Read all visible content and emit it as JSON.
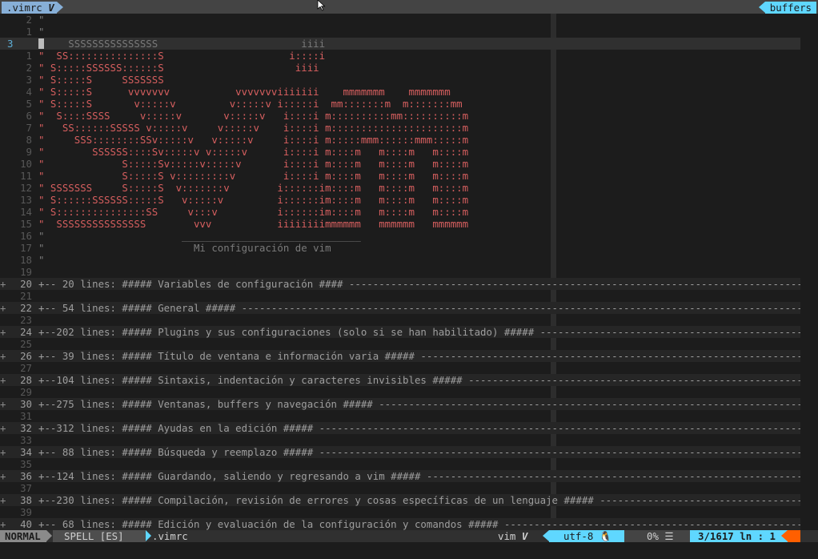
{
  "tabline": {
    "left_tab": ".vimrc",
    "left_icon": "V",
    "right_tab": "buffers"
  },
  "editor": {
    "lines": [
      {
        "n": "2",
        "t": "\"",
        "kind": "comment"
      },
      {
        "n": "1",
        "t": "\"",
        "kind": "comment"
      },
      {
        "n": "3",
        "t": "\"    SSSSSSSSSSSSSSS                        iiii",
        "kind": "cur"
      },
      {
        "n": "1",
        "t": "\"  SS:::::::::::::::S                     i::::i",
        "kind": "art"
      },
      {
        "n": "2",
        "t": "\" S:::::SSSSSS::::::S                      iiii",
        "kind": "art"
      },
      {
        "n": "3",
        "t": "\" S:::::S     SSSSSSS",
        "kind": "art"
      },
      {
        "n": "4",
        "t": "\" S:::::S      vvvvvvv           vvvvvvviiiiiii    mmmmmmm    mmmmmmm",
        "kind": "art"
      },
      {
        "n": "5",
        "t": "\" S:::::S       v:::::v         v:::::v i:::::i  mm:::::::m  m:::::::mm",
        "kind": "art"
      },
      {
        "n": "6",
        "t": "\"  S::::SSSS     v:::::v       v:::::v   i::::i m::::::::::mm::::::::::m",
        "kind": "art"
      },
      {
        "n": "7",
        "t": "\"   SS::::::SSSSS v:::::v     v:::::v    i::::i m::::::::::::::::::::::m",
        "kind": "art"
      },
      {
        "n": "8",
        "t": "\"     SSS::::::::SSv:::::v   v:::::v     i::::i m:::::mmm::::::mmm:::::m",
        "kind": "art"
      },
      {
        "n": "9",
        "t": "\"        SSSSSS::::Sv:::::v v:::::v      i::::i m::::m   m::::m   m::::m",
        "kind": "art"
      },
      {
        "n": "10",
        "t": "\"             S:::::Sv:::::v:::::v       i::::i m::::m   m::::m   m::::m",
        "kind": "art"
      },
      {
        "n": "11",
        "t": "\"             S:::::S v:::::::::v        i::::i m::::m   m::::m   m::::m",
        "kind": "art"
      },
      {
        "n": "12",
        "t": "\" SSSSSSS     S:::::S  v:::::::v        i::::::im::::m   m::::m   m::::m",
        "kind": "art"
      },
      {
        "n": "13",
        "t": "\" S::::::SSSSSS:::::S   v:::::v         i::::::im::::m   m::::m   m::::m",
        "kind": "art"
      },
      {
        "n": "14",
        "t": "\" S:::::::::::::::SS     v:::v          i::::::im::::m   m::::m   m::::m",
        "kind": "art"
      },
      {
        "n": "15",
        "t": "\"  SSSSSSSSSSSSSSS        vvv           iiiiiiiimmmmmm   mmmmmm   mmmmmm",
        "kind": "art"
      },
      {
        "n": "16",
        "t": "\"                       ______________________________",
        "kind": "comment"
      },
      {
        "n": "17",
        "t": "\"                         Mi configuración de vim",
        "kind": "comment"
      },
      {
        "n": "18",
        "t": "\"",
        "kind": "comment"
      },
      {
        "n": "19",
        "t": "",
        "kind": "blank"
      },
      {
        "n": "20",
        "t": "+-- 20 lines: ##### Variables de configuración #### ---------------------------------------------------------------------------------------------",
        "kind": "fold"
      },
      {
        "n": "21",
        "t": "",
        "kind": "blank"
      },
      {
        "n": "22",
        "t": "+-- 54 lines: ##### General ##### ----------------------------------------------------------------------------------------------------------------",
        "kind": "fold"
      },
      {
        "n": "23",
        "t": "",
        "kind": "blank"
      },
      {
        "n": "24",
        "t": "+--202 lines: ##### Plugins y sus configuraciones (solo si se han habilitado) ##### ---------------------------------------------------------------",
        "kind": "fold"
      },
      {
        "n": "25",
        "t": "",
        "kind": "blank"
      },
      {
        "n": "26",
        "t": "+-- 39 lines: ##### Título de ventana e información varia ##### ----------------------------------------------------------------------------------",
        "kind": "fold"
      },
      {
        "n": "27",
        "t": "",
        "kind": "blank"
      },
      {
        "n": "28",
        "t": "+--104 lines: ##### Sintaxis, indentación y caracteres invisibles ##### --------------------------------------------------------------------------",
        "kind": "fold"
      },
      {
        "n": "29",
        "t": "",
        "kind": "blank"
      },
      {
        "n": "30",
        "t": "+--275 lines: ##### Ventanas, buffers y navegación ##### -----------------------------------------------------------------------------------------",
        "kind": "fold"
      },
      {
        "n": "31",
        "t": "",
        "kind": "blank"
      },
      {
        "n": "32",
        "t": "+--312 lines: ##### Ayudas en la edición ##### -------------------------------------------------------------------------------------------------",
        "kind": "fold"
      },
      {
        "n": "33",
        "t": "",
        "kind": "blank"
      },
      {
        "n": "34",
        "t": "+-- 88 lines: ##### Búsqueda y reemplazo ##### -------------------------------------------------------------------------------------------------",
        "kind": "fold"
      },
      {
        "n": "35",
        "t": "",
        "kind": "blank"
      },
      {
        "n": "36",
        "t": "+--124 lines: ##### Guardando, saliendo y regresando a vim ##### --------------------------------------------------------------------------------",
        "kind": "fold"
      },
      {
        "n": "37",
        "t": "",
        "kind": "blank"
      },
      {
        "n": "38",
        "t": "+--230 lines: ##### Compilación, revisión de errores y cosas específicas de un lenguaje ##### ---------------------------------------------------",
        "kind": "fold"
      },
      {
        "n": "39",
        "t": "",
        "kind": "blank"
      },
      {
        "n": "40",
        "t": "+-- 68 lines: ##### Edición y evaluación de la configuración y comandos ##### -------------------------------------------------------------------",
        "kind": "fold"
      }
    ]
  },
  "statusline": {
    "mode": "NORMAL",
    "spell": "SPELL [ES]",
    "file": ".vimrc",
    "filetype": "vim",
    "filetype_icon": "V",
    "encoding": "utf-8",
    "encoding_icon": "🐧",
    "percent": "0%",
    "percent_icon": "☰",
    "position": "3/1617",
    "position_sep": "ln :",
    "column": "1"
  }
}
